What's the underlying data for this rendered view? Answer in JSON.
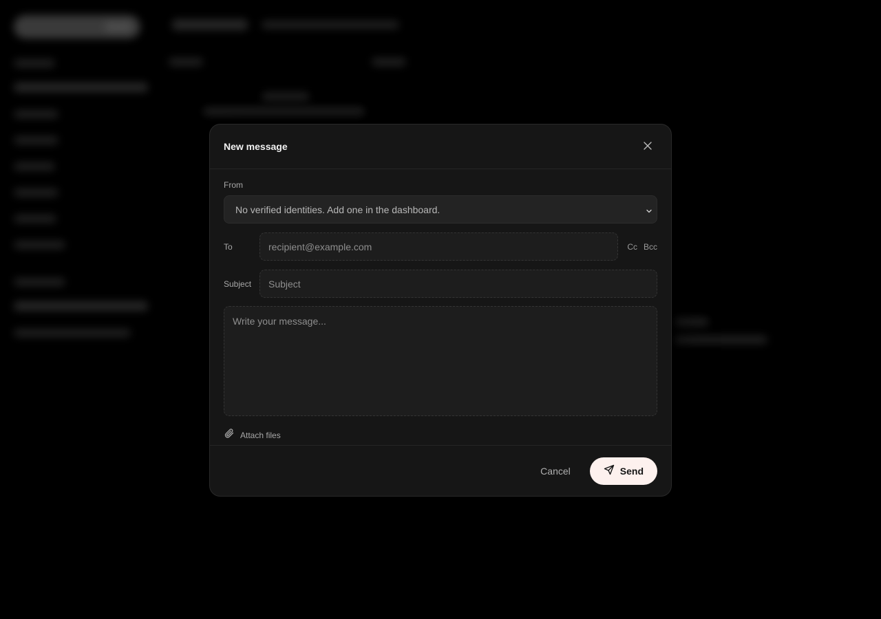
{
  "modal": {
    "title": "New message",
    "from_label": "From",
    "from_selected": "No verified identities. Add one in the dashboard.",
    "to_label": "To",
    "to_placeholder": "recipient@example.com",
    "cc_label": "Cc",
    "bcc_label": "Bcc",
    "subject_label": "Subject",
    "subject_placeholder": "Subject",
    "message_placeholder": "Write your message...",
    "attach_label": "Attach files",
    "cancel_label": "Cancel",
    "send_label": "Send"
  },
  "icons": {
    "close": "close-icon",
    "chevron": "chevron-down-icon",
    "attach": "paperclip-icon",
    "send": "send-icon"
  },
  "colors": {
    "send_bg": "#fdf1ee",
    "modal_bg": "#161616"
  }
}
